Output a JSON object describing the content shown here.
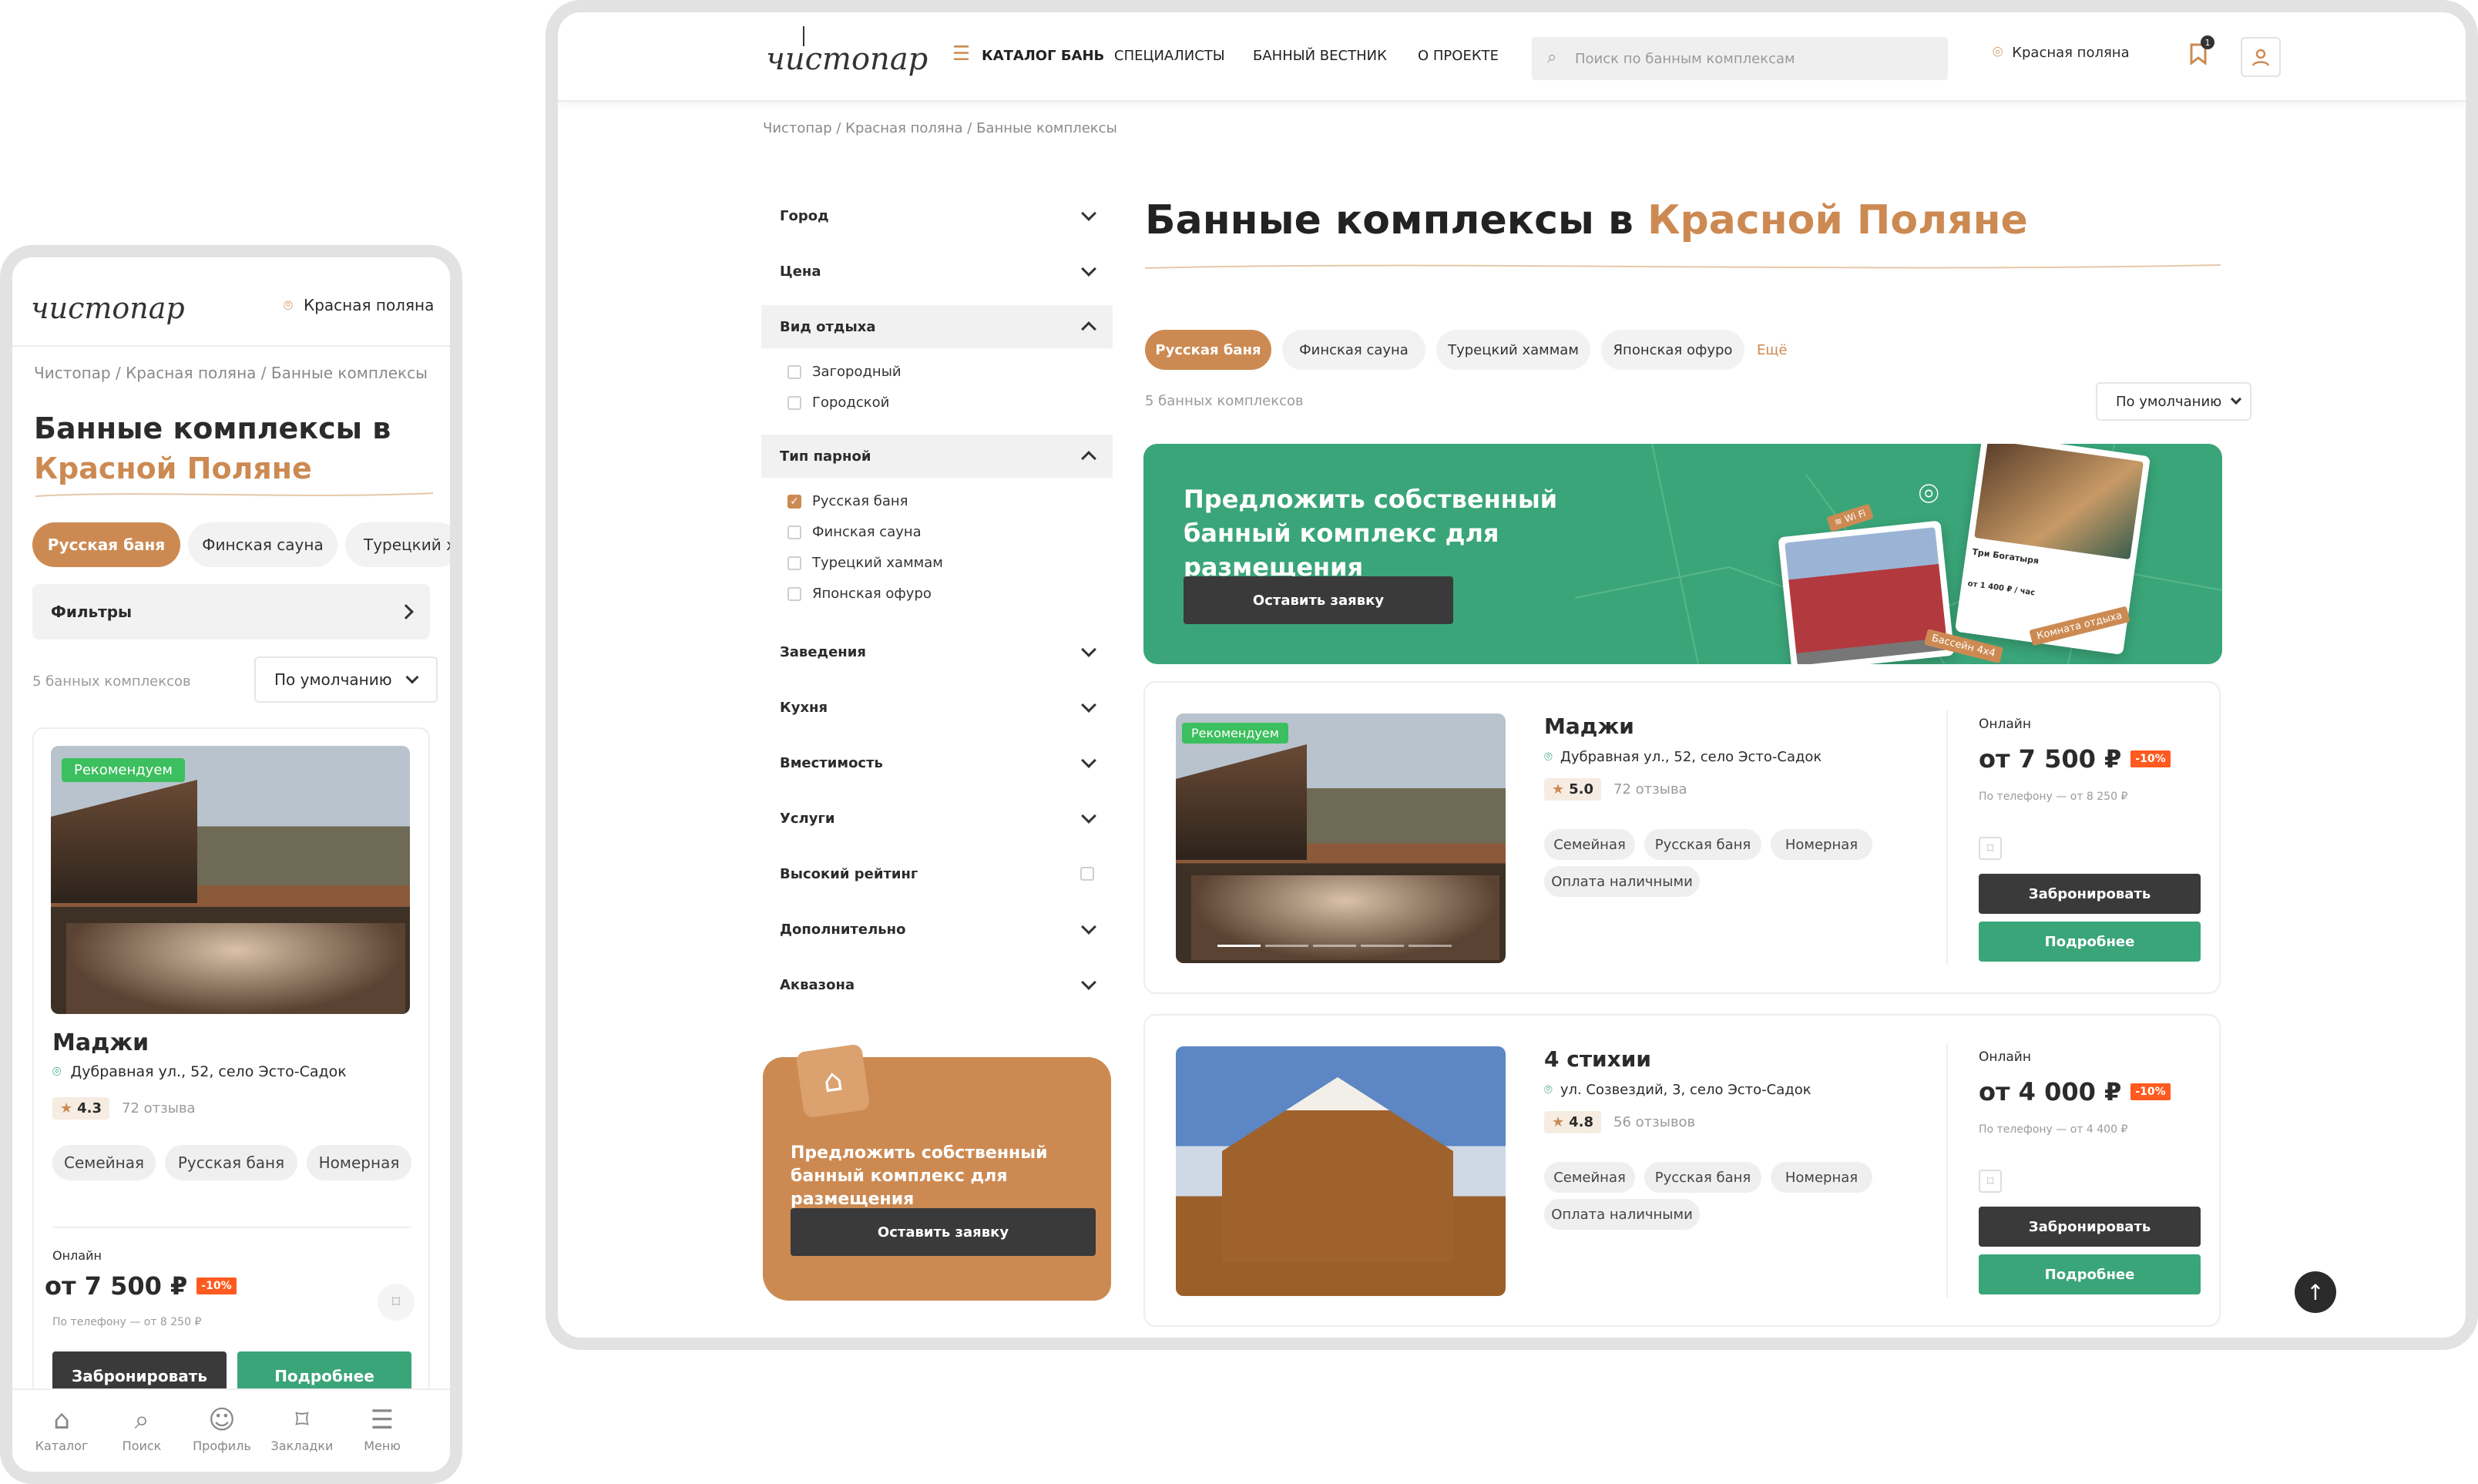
{
  "brand": {
    "logo": "чистопар",
    "accent": "#cc8a52",
    "green": "#3aa579",
    "dark": "#3a3a3a",
    "discount": "#ff5a1f"
  },
  "header": {
    "nav": [
      "КАТАЛОГ БАНЬ",
      "СПЕЦИАЛИСТЫ",
      "БАННЫЙ ВЕСТНИК",
      "О ПРОЕКТЕ"
    ],
    "search_placeholder": "Поиск по банным комплексам",
    "location": "Красная поляна",
    "bookmarks_count": "1"
  },
  "breadcrumb": "Чистопар / Красная поляна / Банные комплексы",
  "title": {
    "prefix": "Банные комплексы в",
    "accent": "Красной Поляне"
  },
  "filters": {
    "city": "Город",
    "price": "Цена",
    "rest_type": {
      "label": "Вид отдыха",
      "options": [
        "Загородный",
        "Городской"
      ]
    },
    "steam_type": {
      "label": "Тип парной",
      "options": [
        "Русская баня",
        "Финская сауна",
        "Турецкий хаммам",
        "Японская офуро"
      ]
    },
    "more": [
      "Заведения",
      "Кухня",
      "Вместимость",
      "Услуги"
    ],
    "high_rating": "Высокий рейтинг",
    "extra": [
      "Дополнительно",
      "Аквазона"
    ]
  },
  "categories": [
    "Русская баня",
    "Финская сауна",
    "Турецкий хаммам",
    "Японская офуро"
  ],
  "categories_more": "Ещё",
  "results_count": "5 банных комплексов",
  "sort": "По умолчанию",
  "promo": {
    "title": "Предложить собственный банный комплекс для размещения",
    "button": "Оставить заявку",
    "sticker_wifi": "Wi Fi",
    "sticker_pool": "Бассейн 4х4",
    "sticker_room": "Комната отдыха",
    "mini_name": "Три Богатыря",
    "mini_price": "от 1 400 ₽ / час"
  },
  "sidebar_promo": {
    "title": "Предложить собственный банный комплекс для размещения",
    "button": "Оставить заявку"
  },
  "listings": [
    {
      "badge": "Рекомендуем",
      "name": "Маджи",
      "address": "Дубравная ул., 52, село Эсто-Садок",
      "rating": "5.0",
      "reviews": "72 отзыва",
      "tags": [
        "Семейная",
        "Русская баня",
        "Номерная",
        "Оплата наличными"
      ],
      "online": "Онлайн",
      "price": "от 7 500 ₽",
      "discount": "-10%",
      "phone_price": "По телефону — от 8 250 ₽",
      "book": "Забронировать",
      "details": "Подробнее"
    },
    {
      "badge": "",
      "name": "4 стихии",
      "address": "ул. Созвездий, 3, село Эсто-Садок",
      "rating": "4.8",
      "reviews": "56 отзывов",
      "tags": [
        "Семейная",
        "Русская баня",
        "Номерная",
        "Оплата наличными"
      ],
      "online": "Онлайн",
      "price": "от 4 000 ₽",
      "discount": "-10%",
      "phone_price": "По телефону — от 4 400 ₽",
      "book": "Забронировать",
      "details": "Подробнее"
    }
  ],
  "mobile": {
    "location": "Красная поляна",
    "chips": [
      "Русская баня",
      "Финская сауна",
      "Турецкий х"
    ],
    "filters_label": "Фильтры",
    "card_rating": "4.3",
    "tabs": [
      "Каталог",
      "Поиск",
      "Профиль",
      "Закладки",
      "Меню"
    ]
  }
}
